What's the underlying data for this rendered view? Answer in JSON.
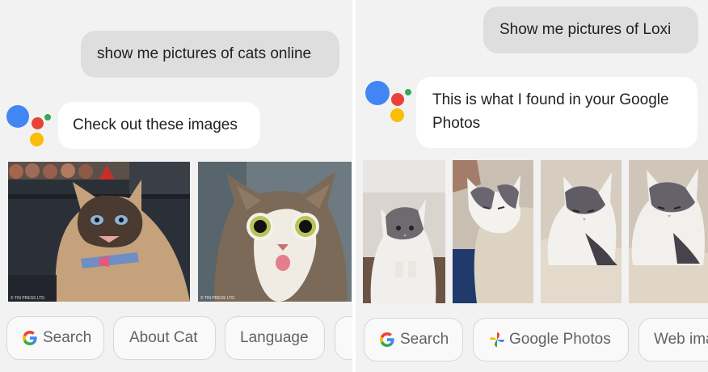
{
  "left": {
    "user_query": "show me pictures of cats online",
    "assistant_reply": "Check out these images",
    "images": [
      {
        "caption": "© TIN PRESS LTD."
      },
      {
        "caption": "© TIN PRESS LTD."
      }
    ],
    "chips": [
      {
        "label": "Search",
        "icon": "google-g-icon"
      },
      {
        "label": "About Cat"
      },
      {
        "label": "Language"
      }
    ]
  },
  "right": {
    "user_query": "Show me pictures of Loxi",
    "assistant_reply_line1": "This is what I found in your Google",
    "assistant_reply_line2": "Photos",
    "chips": [
      {
        "label": "Search",
        "icon": "google-g-icon"
      },
      {
        "label": "Google Photos",
        "icon": "google-photos-pinwheel-icon"
      },
      {
        "label": "Web ima"
      }
    ]
  },
  "colors": {
    "assistant_blue": "#4285f4",
    "assistant_red": "#ea4335",
    "assistant_yellow": "#fbbc05",
    "assistant_green": "#34a853",
    "panel_bg": "#f2f2f2",
    "user_bubble_bg": "#dedede"
  }
}
